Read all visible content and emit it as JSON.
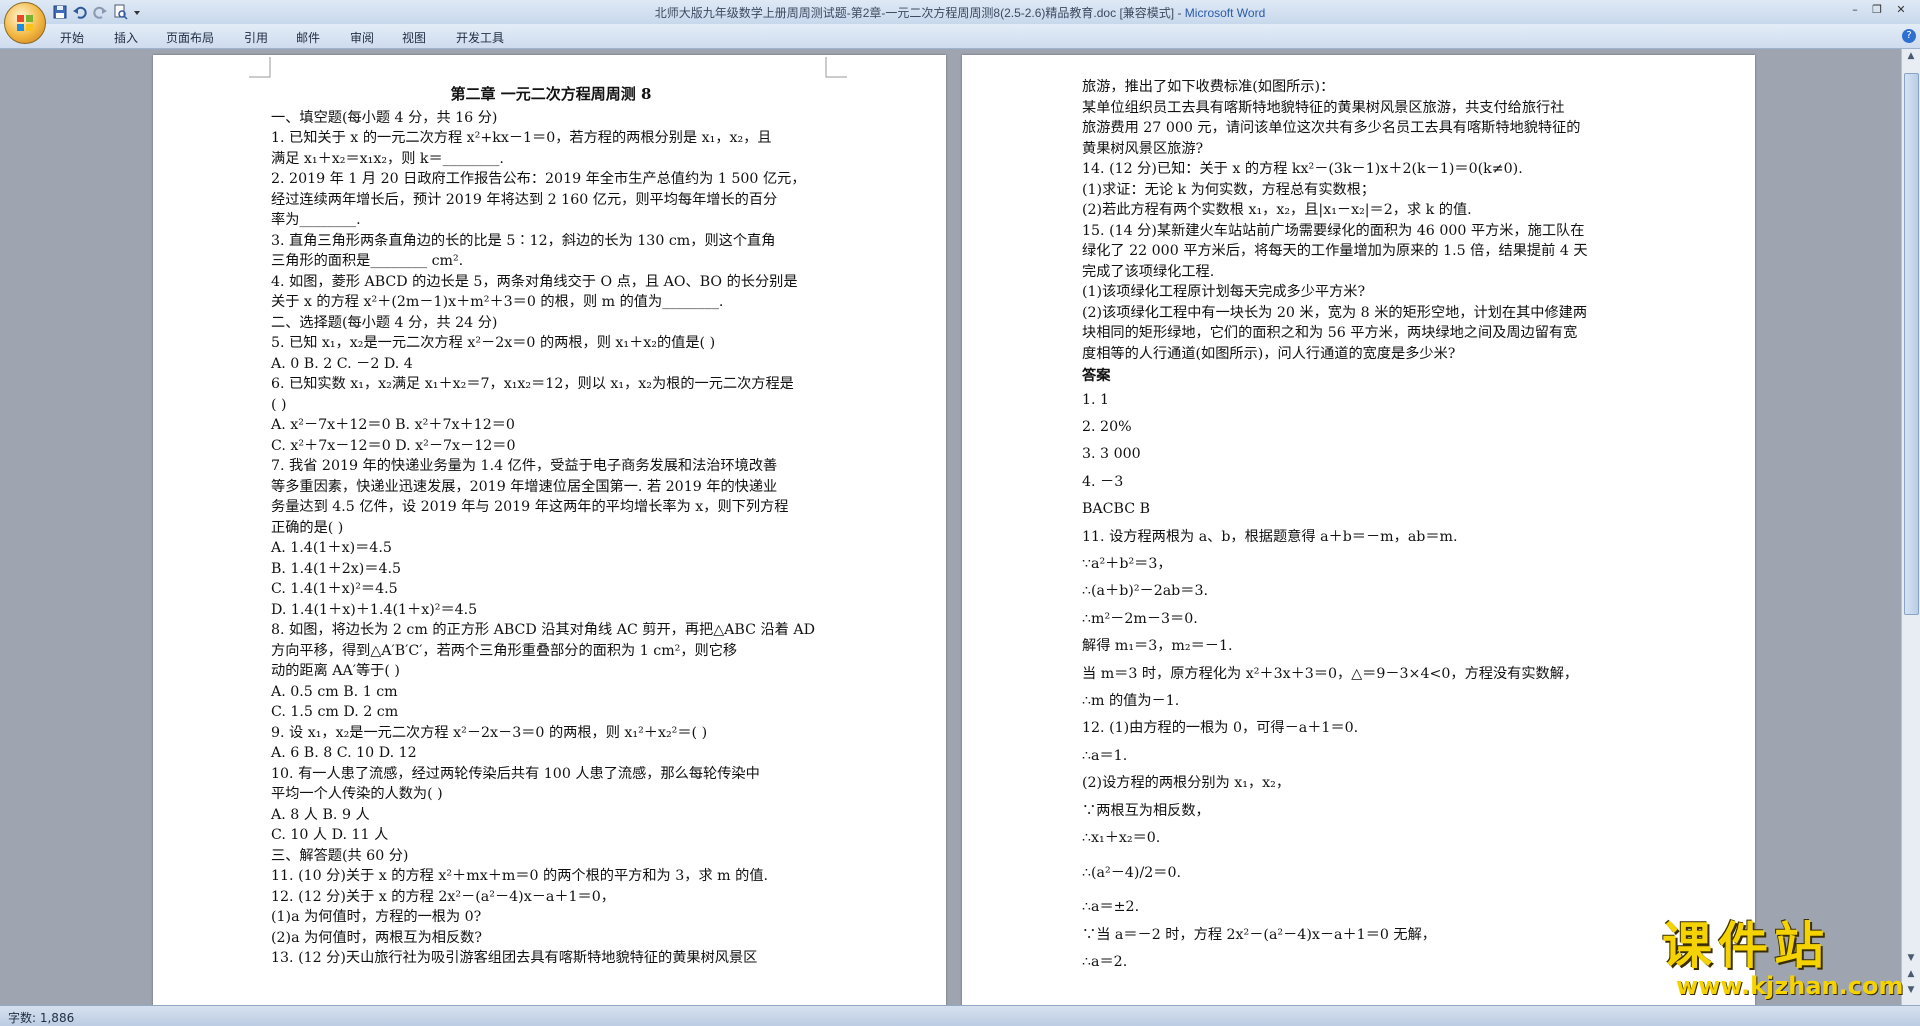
{
  "window": {
    "title": "北师大版九年级数学上册周周测试题-第2章-一元二次方程周周测8(2.5-2.6)精品教育.doc [兼容模式] - ",
    "app_name": "Microsoft Word"
  },
  "ribbon_tabs": [
    "开始",
    "插入",
    "页面布局",
    "引用",
    "邮件",
    "审阅",
    "视图",
    "开发工具"
  ],
  "status": {
    "word_count": "字数: 1,886"
  },
  "watermark": {
    "brand": "课件站",
    "url": "www.kjzhan.com"
  },
  "page1_lines": [
    "第二章  一元二次方程周周测 8",
    "一、填空题(每小题 4 分，共 16 分)",
    "1. 已知关于 x 的一元二次方程 x²+kx－1＝0，若方程的两根分别是 x₁，x₂，且",
    "满足 x₁＋x₂＝x₁x₂，则 k＝________.",
    "2. 2019 年 1 月 20 日政府工作报告公布：2019 年全市生产总值约为 1 500 亿元，",
    "经过连续两年增长后，预计 2019 年将达到 2 160 亿元，则平均每年增长的百分",
    "率为________.",
    "3. 直角三角形两条直角边的长的比是 5∶12，斜边的长为 130 cm，则这个直角",
    "三角形的面积是________ cm².",
    "4. 如图，菱形 ABCD 的边长是 5，两条对角线交于 O 点，且 AO、BO 的长分别是",
    "关于 x 的方程 x²＋(2m－1)x＋m²＋3＝0 的根，则 m 的值为________.",
    "二、选择题(每小题 4 分，共 24 分)",
    "5. 已知 x₁，x₂是一元二次方程 x²－2x＝0 的两根，则 x₁＋x₂的值是(      )",
    "A. 0            B. 2            C. －2            D. 4",
    "6. 已知实数 x₁，x₂满足 x₁＋x₂＝7，x₁x₂＝12，则以 x₁，x₂为根的一元二次方程是",
    "(      )",
    "A. x²－7x＋12＝0                           B. x²＋7x＋12＝0",
    "C. x²＋7x－12＝0                           D. x²－7x－12＝0",
    "7. 我省 2019 年的快递业务量为 1.4 亿件，受益于电子商务发展和法治环境改善",
    "等多重因素，快递业迅速发展，2019 年增速位居全国第一. 若 2019 年的快递业",
    "务量达到 4.5 亿件，设 2019 年与 2019 年这两年的平均增长率为 x，则下列方程",
    "正确的是(      )",
    "A. 1.4(1＋x)＝4.5",
    "B. 1.4(1＋2x)＝4.5",
    "C. 1.4(1＋x)²＝4.5",
    "D. 1.4(1＋x)＋1.4(1＋x)²＝4.5",
    "8. 如图，将边长为 2 cm 的正方形 ABCD 沿其对角线 AC 剪开，再把△ABC 沿着 AD",
    "方向平移，得到△A′B′C′，若两个三角形重叠部分的面积为 1 cm²，则它移",
    "动的距离 AA′等于(      )",
    "A. 0.5 cm                              B. 1 cm",
    "C. 1.5 cm                              D. 2 cm",
    "9. 设 x₁，x₂是一元二次方程 x²－2x－3＝0 的两根，则 x₁²＋x₂²＝(      )",
    "A. 6              B. 8              C. 10              D. 12",
    "10. 有一人患了流感，经过两轮传染后共有 100 人患了流感，那么每轮传染中",
    "平均一个人传染的人数为(      )",
    "A. 8 人                                    B. 9 人",
    "C. 10 人                                   D. 11 人",
    "三、解答题(共 60 分)",
    "11. (10 分)关于 x 的方程 x²＋mx＋m＝0 的两个根的平方和为 3，求 m 的值.",
    "12. (12 分)关于 x 的方程 2x²－(a²－4)x－a＋1＝0，",
    "(1)a 为何值时，方程的一根为 0?",
    "(2)a 为何值时，两根互为相反数?",
    "13. (12 分)天山旅行社为吸引游客组团去具有喀斯特地貌特征的黄果树风景区"
  ],
  "page2_lines": [
    "旅游，推出了如下收费标准(如图所示)：",
    "某单位组织员工去具有喀斯特地貌特征的黄果树风景区旅游，共支付给旅行社",
    "旅游费用 27 000 元，请问该单位这次共有多少名员工去具有喀斯特地貌特征的",
    "黄果树风景区旅游?",
    "14. (12 分)已知：关于 x 的方程 kx²－(3k－1)x＋2(k－1)＝0(k≠0).",
    "(1)求证：无论 k 为何实数，方程总有实数根；",
    "(2)若此方程有两个实数根 x₁，x₂，且|x₁－x₂|＝2，求 k 的值.",
    "15. (14 分)某新建火车站站前广场需要绿化的面积为 46 000 平方米，施工队在",
    "绿化了 22 000 平方米后，将每天的工作量增加为原来的 1.5 倍，结果提前 4 天",
    "完成了该项绿化工程.",
    "(1)该项绿化工程原计划每天完成多少平方米?",
    "(2)该项绿化工程中有一块长为 20 米，宽为 8 米的矩形空地，计划在其中修建两",
    "块相同的矩形绿地，它们的面积之和为 56 平方米，两块绿地之间及周边留有宽",
    "度相等的人行通道(如图所示)，问人行通道的宽度是多少米?"
  ],
  "answers_heading": "答案",
  "answer_lines": [
    "1. 1",
    "2. 20%",
    "3. 3 000",
    "4. －3",
    "BACBC B",
    "11. 设方程两根为 a、b，根据题意得 a＋b＝－m，ab＝m.",
    "∵a²＋b²＝3，",
    "∴(a＋b)²－2ab＝3.",
    "∴m²－2m－3＝0.",
    "解得 m₁＝3，m₂＝－1.",
    "当 m＝3 时，原方程化为 x²＋3x＋3＝0，△＝9－3×4<0，方程没有实数解，",
    "∴m 的值为－1.",
    "12. (1)由方程的一根为 0，可得－a＋1＝0.",
    "∴a＝1.",
    "(2)设方程的两根分别为 x₁，x₂，",
    "∵两根互为相反数，",
    "∴x₁＋x₂＝0.",
    "∴(a²－4)/2＝0.",
    "∴a＝±2.",
    "∵当 a＝－2 时，方程 2x²－(a²－4)x－a＋1＝0 无解，",
    "∴a＝2."
  ]
}
